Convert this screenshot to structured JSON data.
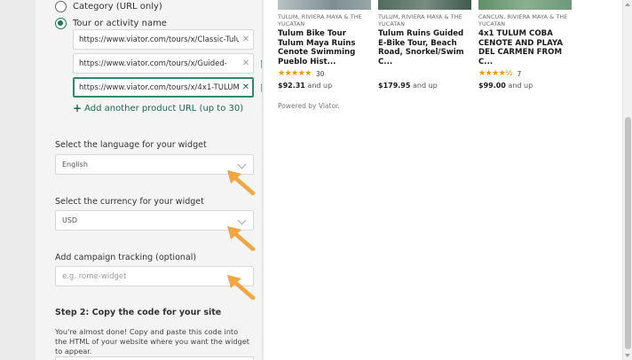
{
  "config": {
    "radio_category": "Category (URL only)",
    "radio_tour": "Tour or activity name",
    "urls": [
      "https://www.viator.com/tours/x/Classic-Tulum",
      "https://www.viator.com/tours/x/Guided-",
      "https://www.viator.com/tours/x/4x1-TULUM"
    ],
    "add_product": "Add another product URL (up to 30)",
    "language_label": "Select the language for your widget",
    "language_value": "English",
    "currency_label": "Select the currency for your widget",
    "currency_value": "USD",
    "campaign_label": "Add campaign tracking (optional)",
    "campaign_placeholder": "e.g. rome-widget",
    "step2_heading": "Step 2: Copy the code for your site",
    "step2_desc": "You're almost done! Copy and paste this code into the HTML of your website where you want the widget to appear."
  },
  "preview": {
    "cards": [
      {
        "location": "TULUM, RIVIERA MAYA & THE YUCATAN",
        "title": "Tulum Bike Tour Tulum Maya Ruins Cenote Swimming Pueblo Hist...",
        "stars": "★★★★★",
        "rating_value": 5,
        "reviews": "30",
        "price": "$92.31",
        "price_suffix": "and up",
        "image_color": "#8fa0a6"
      },
      {
        "location": "TULUM, RIVIERA MAYA & THE YUCATAN",
        "title": "Tulum Ruins Guided E-Bike Tour, Beach Road, Snorkel/Swim C...",
        "stars": "",
        "reviews": "",
        "price": "$179.95",
        "price_suffix": "and up",
        "image_color": "#5f7a6e"
      },
      {
        "location": "CANCUN, RIVIERA MAYA & THE YUCATAN",
        "title": "4x1 TULUM COBA CENOTE AND PLAYA DEL CARMEN FROM C...",
        "stars": "★★★★½",
        "rating_value": 4.5,
        "reviews": "7",
        "price": "$99.00",
        "price_suffix": "and up",
        "image_color": "#6f9a78"
      }
    ],
    "powered_by": "Powered by Viator."
  },
  "colors": {
    "accent_green": "#1a7a5a",
    "link_green": "#186b4c",
    "star_orange": "#e59a00",
    "pointer_orange": "#f2a540"
  }
}
